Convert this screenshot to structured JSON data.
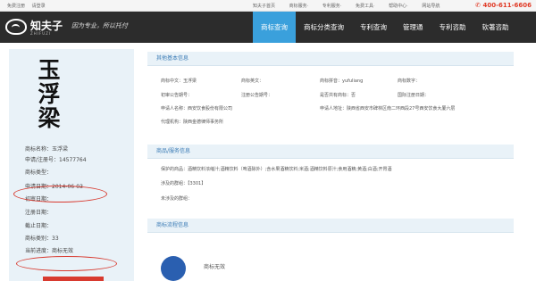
{
  "topbar": {
    "left": [
      "免费注册",
      "请登录"
    ],
    "links": [
      "知夫子首页",
      "商标服务·",
      "专利服务·",
      "免费工具·",
      "帮助中心·",
      "网站导航"
    ],
    "phone": "400-611-6606"
  },
  "header": {
    "brand": "知夫子",
    "brand_sub": "ZHIFUZI",
    "slogan": "因为专业，所以托付",
    "nav": [
      "商标查询",
      "商标分类查询",
      "专利查询",
      "管理通",
      "专利咨助",
      "软著咨助"
    ],
    "active_nav_index": 0
  },
  "trademark": {
    "characters": [
      "玉",
      "浮",
      "梁"
    ],
    "rows": [
      {
        "label": "商标名称：",
        "value": "玉浮梁"
      },
      {
        "label": "申请/注册号：",
        "value": "14577764"
      },
      {
        "label": "商标类型：",
        "value": ""
      },
      {
        "label": "申请日期：",
        "value": "2014-06-03"
      },
      {
        "label": "初审日期：",
        "value": ""
      },
      {
        "label": "注册日期：",
        "value": ""
      },
      {
        "label": "截止日期：",
        "value": ""
      },
      {
        "label": "商标类别：",
        "value": "33"
      },
      {
        "label": "当前进度：",
        "value": "商标无效"
      }
    ]
  },
  "basic_info": {
    "title": "其他基本信息",
    "row1": [
      "商标中文：玉浮梁",
      "商标英文：",
      "商标拼音：yufuliang",
      "商标数字："
    ],
    "row2": [
      "初审公告期号：",
      "注册公告期号：",
      "是否共有商标：否",
      "国际注册日期："
    ],
    "row3": [
      "申请人名称：西安饮食股份有限公司",
      "申请人地址：陕西省西安市碑林区南二环西段27号西安饮食大厦六层"
    ],
    "row4": [
      "代理机构：陕西金德律师事务所"
    ]
  },
  "goods_info": {
    "title": "商品/服务信息",
    "line1": "保护的商品：酒精饮料浓缩汁;酒精饮料（啤酒除外）;含水果酒精饮料;米酒;酒精饮料原汁;食用酒精;黄酒;白酒;开胃酒",
    "line2": "涉及的群组：【3301】",
    "line3": "未涉及的群组："
  },
  "process_info": {
    "title": "商标流程信息",
    "status_label": "商标无效"
  },
  "colors": {
    "accent": "#3aa0dc",
    "header_bg": "#2c2c2c",
    "highlight": "#d83a2f",
    "panel_bg": "#e9f2f8"
  }
}
